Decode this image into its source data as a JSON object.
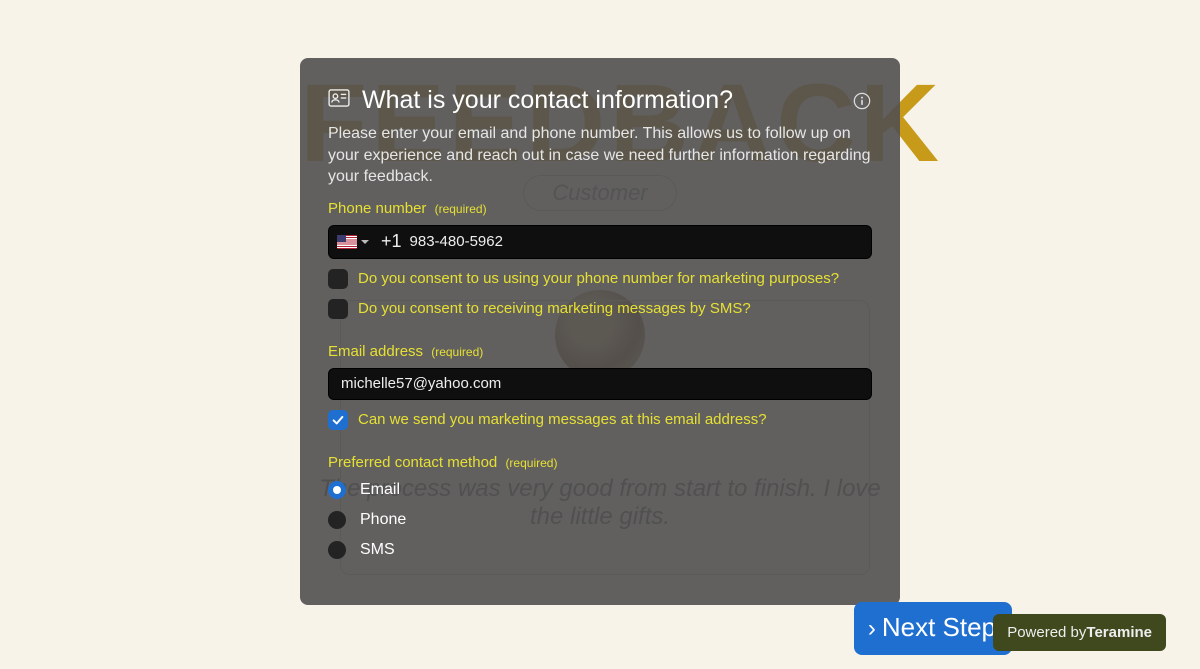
{
  "bg": {
    "word": "FEEDBACK",
    "chip": "Customer",
    "quote": "The process was very good from start to finish. I love the little gifts."
  },
  "modal": {
    "title": "What is your contact information?",
    "desc": "Please enter your email and phone number. This allows us to follow up on your experience and reach out in case we need further information regarding your feedback.",
    "required_label": "(required)"
  },
  "phone": {
    "section_label": "Phone number",
    "dial_code": "+1",
    "value": "983-480-5962",
    "placeholder": "Phone number",
    "consent_marketing_label": "Do you consent to us using your phone number for marketing purposes?",
    "consent_marketing_checked": false,
    "consent_sms_label": "Do you consent to receiving marketing messages by SMS?",
    "consent_sms_checked": false
  },
  "email": {
    "section_label": "Email address",
    "value": "michelle57@yahoo.com",
    "placeholder": "Email address",
    "consent_label": "Can we send you marketing messages at this email address?",
    "consent_checked": true
  },
  "contact_method": {
    "section_label": "Preferred contact method",
    "options": [
      "Email",
      "Phone",
      "SMS"
    ],
    "selected_index": 0
  },
  "footer": {
    "next_label": "Next Step",
    "powered_prefix": "Powered by",
    "powered_brand": "Teramine"
  }
}
